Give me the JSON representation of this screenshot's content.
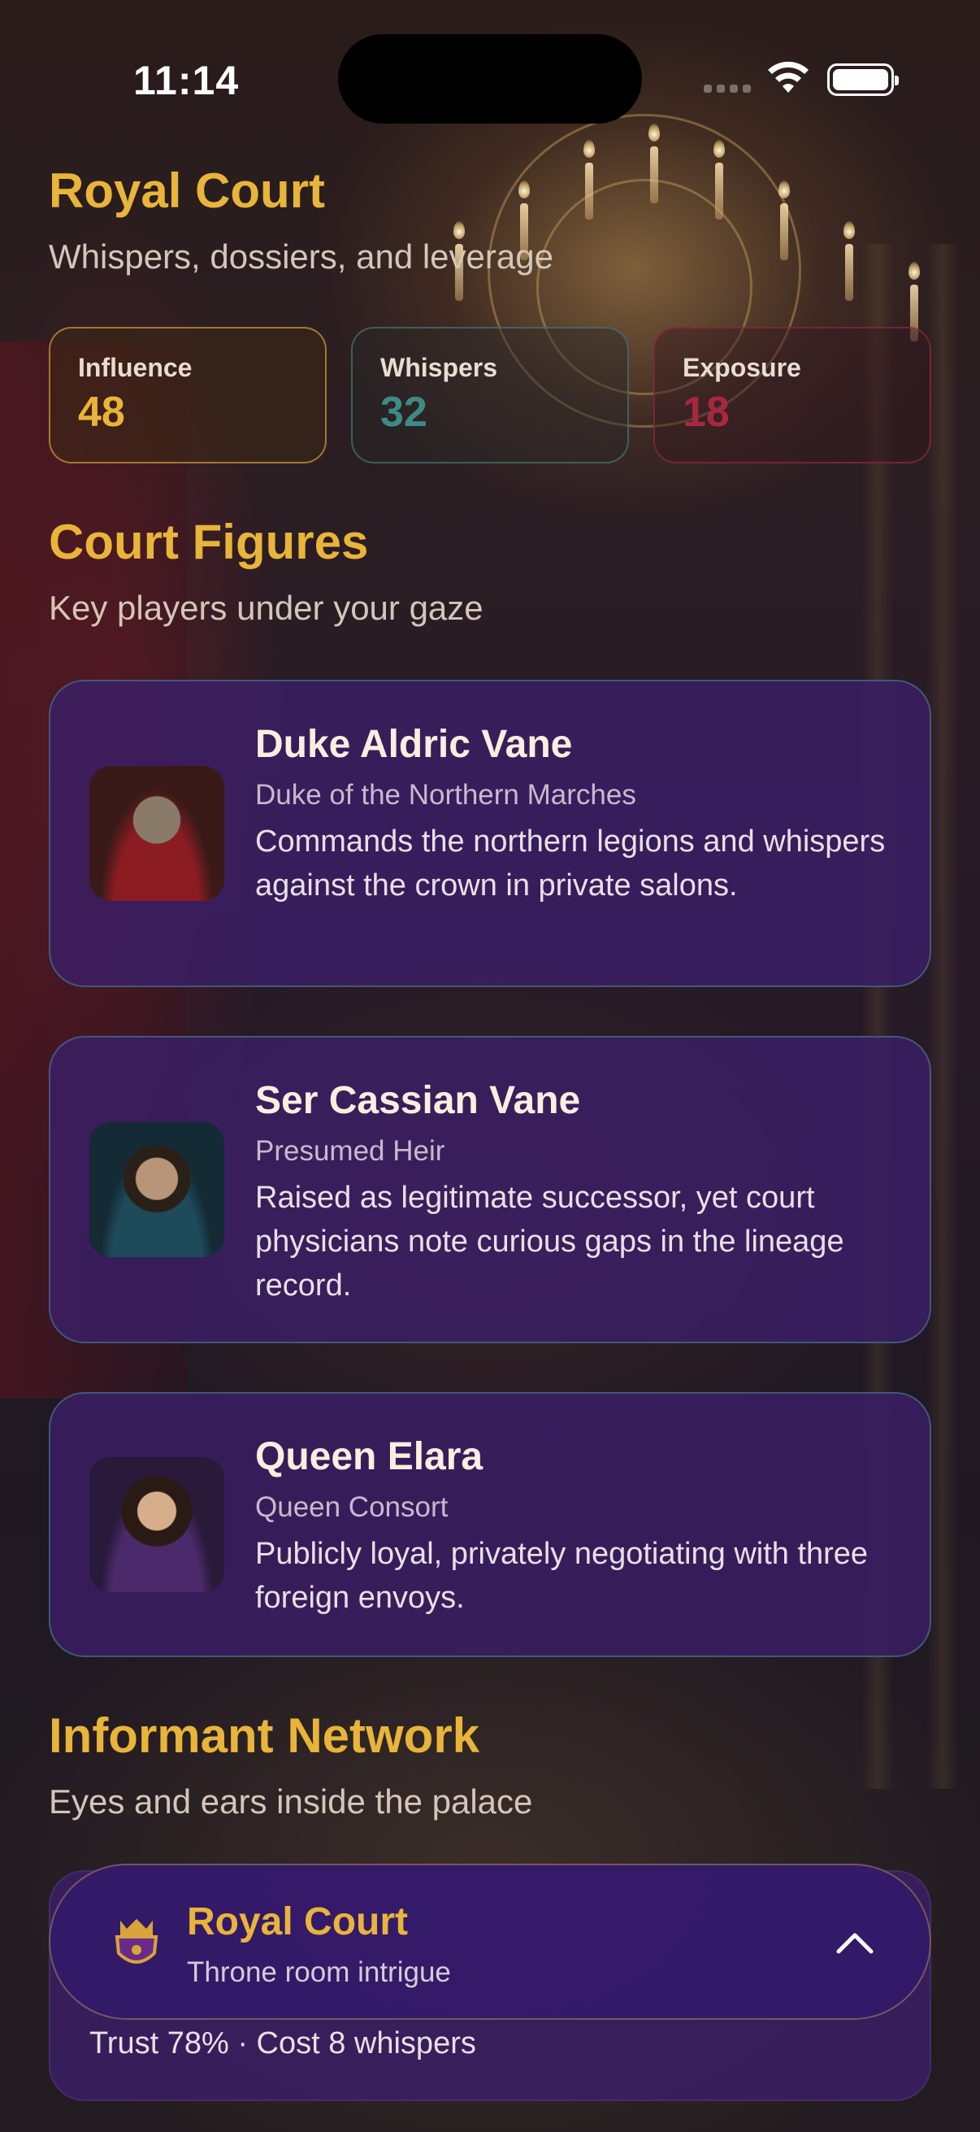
{
  "status_bar": {
    "time": "11:14"
  },
  "header": {
    "title": "Royal Court",
    "subtitle": "Whispers, dossiers, and leverage"
  },
  "stats": [
    {
      "label": "Influence",
      "value": "48",
      "color": "#e8b43a"
    },
    {
      "label": "Whispers",
      "value": "32",
      "color": "#3d8a86"
    },
    {
      "label": "Exposure",
      "value": "18",
      "color": "#a8273f"
    }
  ],
  "court_figures": {
    "title": "Court Figures",
    "subtitle": "Key players under your gaze",
    "items": [
      {
        "name": "Duke Aldric Vane",
        "role": "Duke of the Northern Marches",
        "description": "Commands the northern legions and whispers against the crown in private salons."
      },
      {
        "name": "Ser Cassian Vane",
        "role": "Presumed Heir",
        "description": "Raised as legitimate successor, yet court physicians note curious gaps in the lineage record."
      },
      {
        "name": "Queen Elara",
        "role": "Queen Consort",
        "description": "Publicly loyal, privately negotiating with three foreign envoys."
      }
    ]
  },
  "informant_network": {
    "title": "Informant Network",
    "subtitle": "Eyes and ears inside the palace",
    "first_item": {
      "meta": "Trust 78% · Cost 8 whispers"
    }
  },
  "bottom_bar": {
    "title": "Royal Court",
    "subtitle": "Throne room intrigue"
  },
  "colors": {
    "gold": "#e8b43a",
    "card_purple": "#3a1e64",
    "teal": "#3d8a86",
    "crimson": "#a8273f"
  }
}
